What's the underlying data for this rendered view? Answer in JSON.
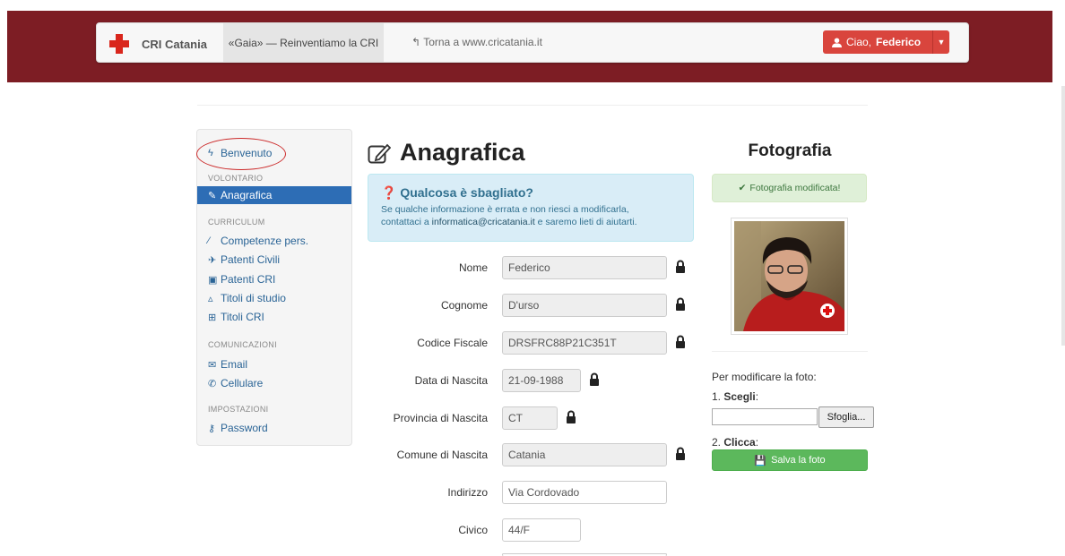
{
  "header": {
    "brand": "CRI Catania",
    "active_tab": "«Gaia» — Reinventiamo la CRI",
    "back_link": "Torna a www.cricatania.it",
    "user_greeting": "Ciao,",
    "user_name": "Federico"
  },
  "sidebar": {
    "welcome": "Benvenuto",
    "sections": [
      {
        "heading": "VOLONTARIO",
        "items": [
          {
            "label": "Anagrafica",
            "icon": "edit-icon",
            "active": true
          }
        ]
      },
      {
        "heading": "CURRICULUM",
        "items": [
          {
            "label": "Competenze pers.",
            "icon": "magic-wand-icon"
          },
          {
            "label": "Patenti Civili",
            "icon": "plane-icon"
          },
          {
            "label": "Patenti CRI",
            "icon": "truck-icon"
          },
          {
            "label": "Titoli di studio",
            "icon": "flask-icon"
          },
          {
            "label": "Titoli CRI",
            "icon": "plus-square-icon"
          }
        ]
      },
      {
        "heading": "COMUNICAZIONI",
        "items": [
          {
            "label": "Email",
            "icon": "envelope-icon"
          },
          {
            "label": "Cellulare",
            "icon": "phone-icon"
          }
        ]
      },
      {
        "heading": "IMPOSTAZIONI",
        "items": [
          {
            "label": "Password",
            "icon": "key-icon"
          }
        ]
      }
    ]
  },
  "main": {
    "title": "Anagrafica",
    "alert": {
      "title": "Qualcosa è sbagliato?",
      "text_1": "Se qualche informazione è errata e non riesci a modificarla,",
      "text_2a": "contattaci a ",
      "email": "informatica@cricatania.it",
      "text_2b": " e saremo lieti di aiutarti."
    },
    "fields": [
      {
        "label": "Nome",
        "value": "Federico",
        "locked": true
      },
      {
        "label": "Cognome",
        "value": "D'urso",
        "locked": true
      },
      {
        "label": "Codice Fiscale",
        "value": "DRSFRC88P21C351T",
        "locked": true
      },
      {
        "label": "Data di Nascita",
        "value": "21-09-1988",
        "locked": true
      },
      {
        "label": "Provincia di Nascita",
        "value": "CT",
        "locked": true
      },
      {
        "label": "Comune di Nascita",
        "value": "Catania",
        "locked": true
      },
      {
        "label": "Indirizzo",
        "value": "Via Cordovado",
        "locked": false
      },
      {
        "label": "Civico",
        "value": "44/F",
        "locked": false
      }
    ]
  },
  "photo": {
    "title": "Fotografia",
    "success": "Fotografia modificata!",
    "instructions": "Per modificare la foto:",
    "step1_num": "1.",
    "step1": "Scegli",
    "browse": "Sfoglia...",
    "step2_num": "2.",
    "step2": "Clicca",
    "save": "Salva la foto"
  },
  "colors": {
    "header_bg": "#7d1d24",
    "brand_red": "#d9261c",
    "user_button": "#d9453d",
    "active_item": "#2d6db5",
    "success_button": "#5cb85c"
  }
}
